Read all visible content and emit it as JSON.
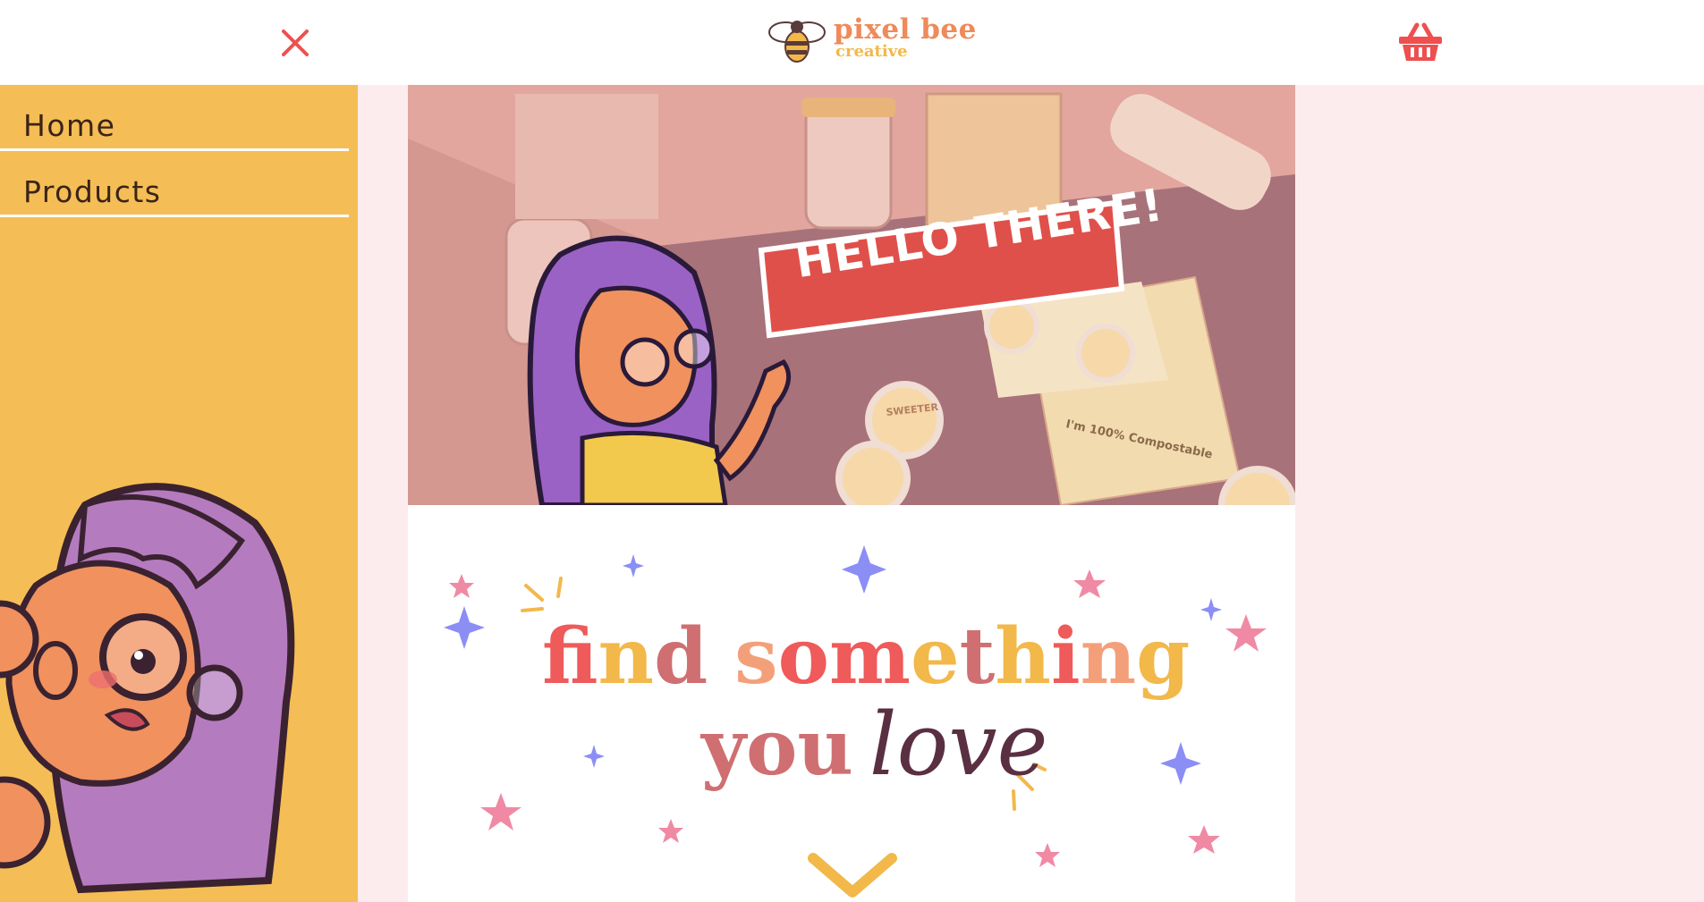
{
  "header": {
    "logo_main": "pixel bee",
    "logo_sub": "creative",
    "brand_colors": {
      "accent": "#ef4f4f",
      "orange": "#ef8a5a",
      "yellow": "#f2b84a"
    }
  },
  "sidebar": {
    "items": [
      {
        "label": "Home"
      },
      {
        "label": "Products"
      }
    ],
    "background": "#f5bd55"
  },
  "hero": {
    "banner": "HELLO THERE!",
    "product_text": "I'm 100% Compostable",
    "sticker_text": "SWEETER"
  },
  "tagline": {
    "words_line1": [
      {
        "text": "f",
        "color": "#ef5a5a"
      },
      {
        "text": "i",
        "color": "#f2b84a"
      },
      {
        "text": "n",
        "color": "#f2b84a"
      },
      {
        "text": "d",
        "color": "#cf6f71"
      },
      {
        "text": " ",
        "color": "#000000"
      },
      {
        "text": "s",
        "color": "#f3a07a"
      },
      {
        "text": "o",
        "color": "#ef5a5a"
      },
      {
        "text": "m",
        "color": "#ef5a5a"
      },
      {
        "text": "e",
        "color": "#f2b84a"
      },
      {
        "text": "t",
        "color": "#cf6f71"
      },
      {
        "text": "h",
        "color": "#f2b84a"
      },
      {
        "text": "i",
        "color": "#ef5a5a"
      },
      {
        "text": "n",
        "color": "#f3a07a"
      },
      {
        "text": "g",
        "color": "#f2b84a"
      }
    ],
    "line2_bold": "you",
    "line2_script": "love"
  }
}
